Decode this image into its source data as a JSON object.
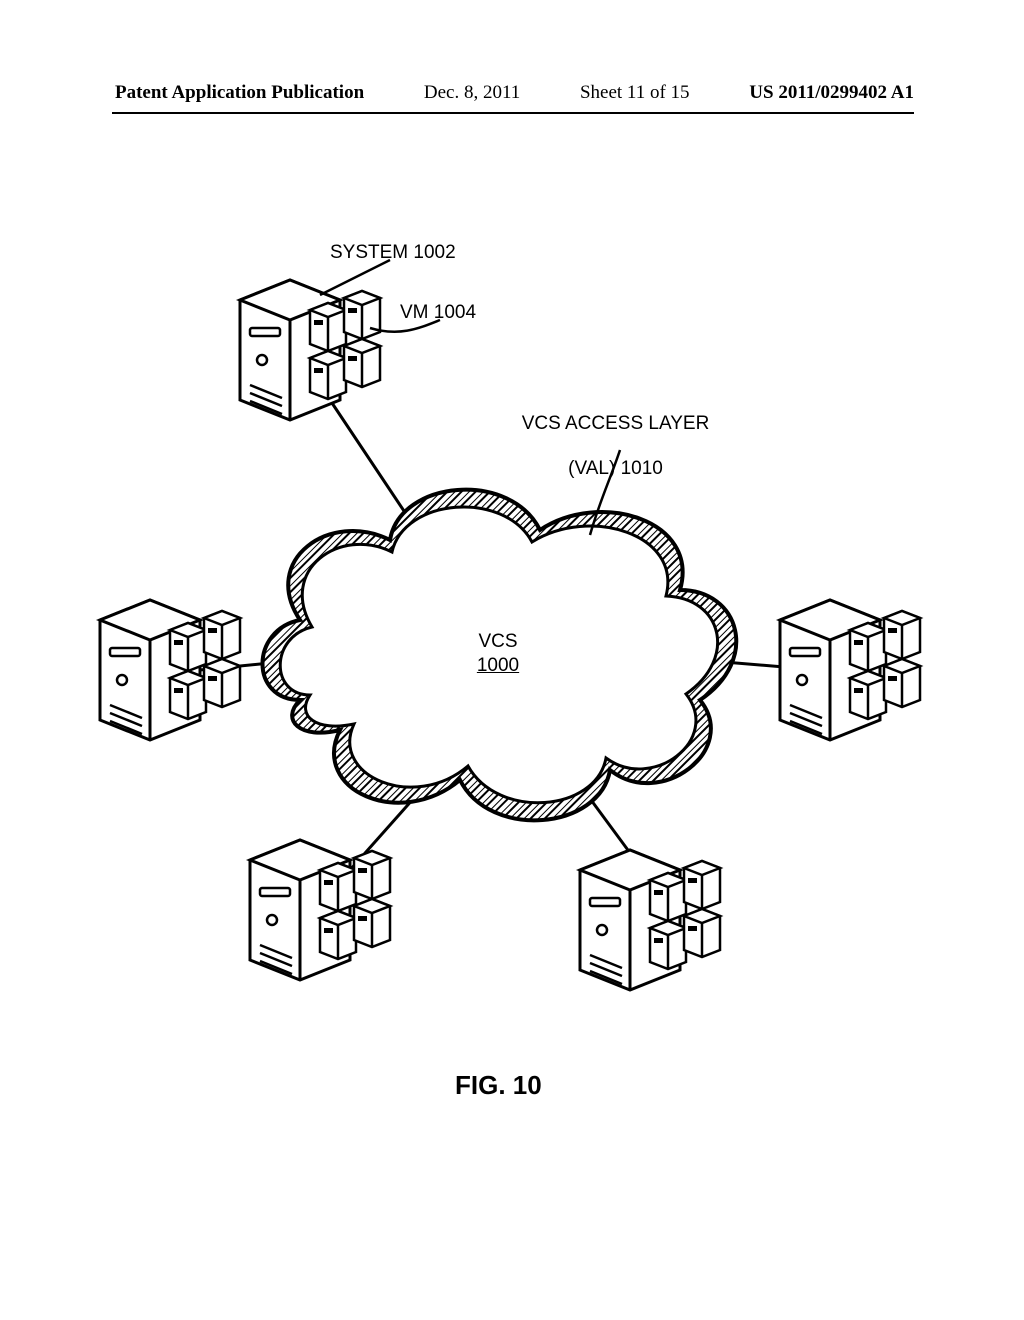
{
  "header": {
    "pub": "Patent Application Publication",
    "date": "Dec. 8, 2011",
    "sheet": "Sheet 11 of 15",
    "pubno": "US 2011/0299402 A1"
  },
  "labels": {
    "system": "SYSTEM 1002",
    "vm": "VM 1004",
    "val_line1": "VCS ACCESS LAYER",
    "val_line2": "(VAL) 1010",
    "vcs_name": "VCS",
    "vcs_num": "1000"
  },
  "figure_caption": "FIG. 10"
}
